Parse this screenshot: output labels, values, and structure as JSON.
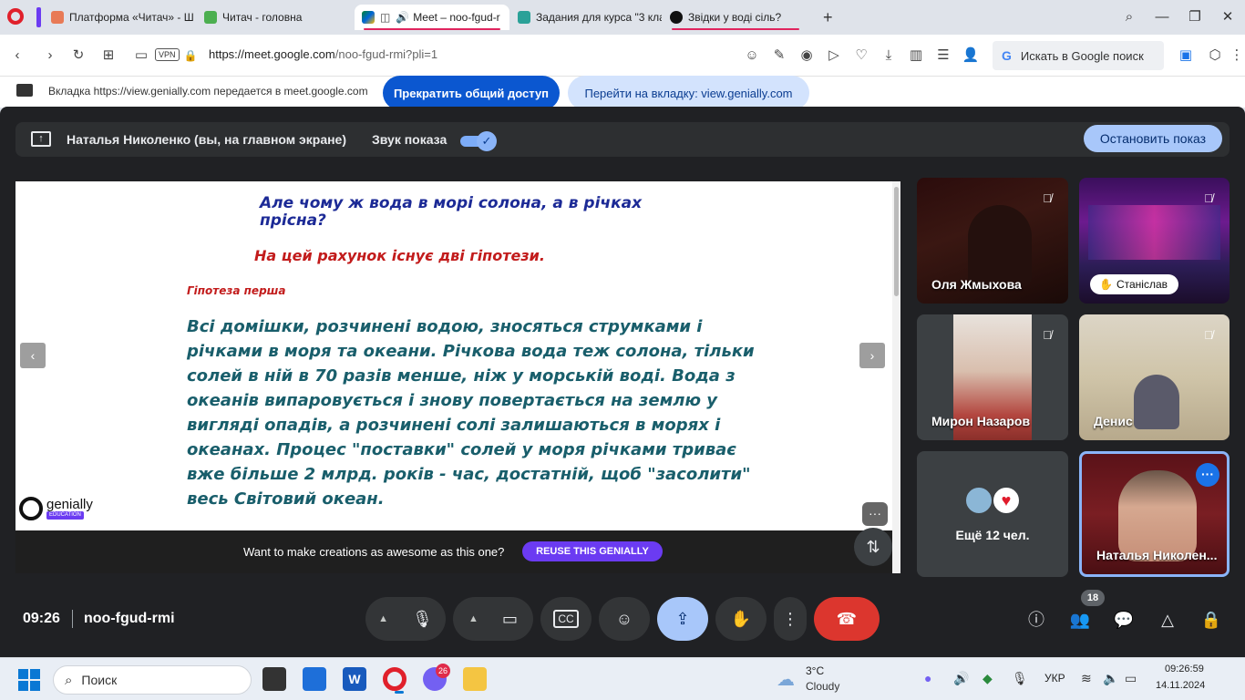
{
  "browser": {
    "tabs": [
      {
        "label": "Платформа «Читач» - Ш",
        "active": false
      },
      {
        "label": "Читач - головна",
        "active": false
      },
      {
        "label": "Meet – noo-fgud-r",
        "active": true
      },
      {
        "label": "Задания для курса \"3 кла",
        "active": false
      },
      {
        "label": "Звідки у воді сіль?",
        "active": false
      }
    ],
    "new_tab": "+",
    "url_host": "https://meet.google.com",
    "url_path": "/noo-fgud-rmi?pli=1",
    "vpn": "VPN",
    "search_label": "Искать в Google поиск"
  },
  "sharebar": {
    "text": "Вкладка https://view.genially.com передается в meet.google.com",
    "stop_label": "Прекратить общий доступ",
    "goto_label": "Перейти на вкладку: view.genially.com"
  },
  "meet": {
    "presenter": "Наталья Николенко (вы, на главном экране)",
    "sound_label": "Звук показа",
    "sound_on": true,
    "stop_show": "Остановить показ",
    "time": "09:26",
    "code": "noo-fgud-rmi",
    "participants_count": "18",
    "accent": "#a8c7fa",
    "end_color": "#dc362e"
  },
  "slide": {
    "question": "Але чому ж вода в морі солона, а в річках прісна?",
    "hypotheses_line": "На цей рахунок існує дві гіпотези.",
    "hypothesis_title": "Гіпотеза перша",
    "body": "Всі домішки, розчинені водою, зносяться струмками і річками в моря та океани. Річкова вода теж солона, тільки солей в ній в 70 разів менше, ніж у морській воді. Вода з океанів випаровується і знову повертається на землю у вигляді опадів, а розчинені солі залишаються в морях і океанах. Процес \"поставки\" солей у моря річками триває вже більше 2 млрд. років - час, достатній, щоб \"засолити\" весь Світовий океан.",
    "genially": "genially",
    "genially_sub": "EDUCATION",
    "reuse_text": "Want to make creations as awesome as this one?",
    "reuse_button": "REUSE THIS GENIALLY"
  },
  "tiles": {
    "t1": "Оля Жмыхова",
    "t2": "Станіслав",
    "t3": "Мирон Назаров",
    "t4": "Денис",
    "t5": "Ещё 12 чел.",
    "t6": "Наталья Николен..."
  },
  "taskbar": {
    "search": "Поиск",
    "badge": "26",
    "temp": "3°C",
    "weather": "Cloudy",
    "lang": "УКР",
    "time": "09:26:59",
    "date": "14.11.2024"
  }
}
